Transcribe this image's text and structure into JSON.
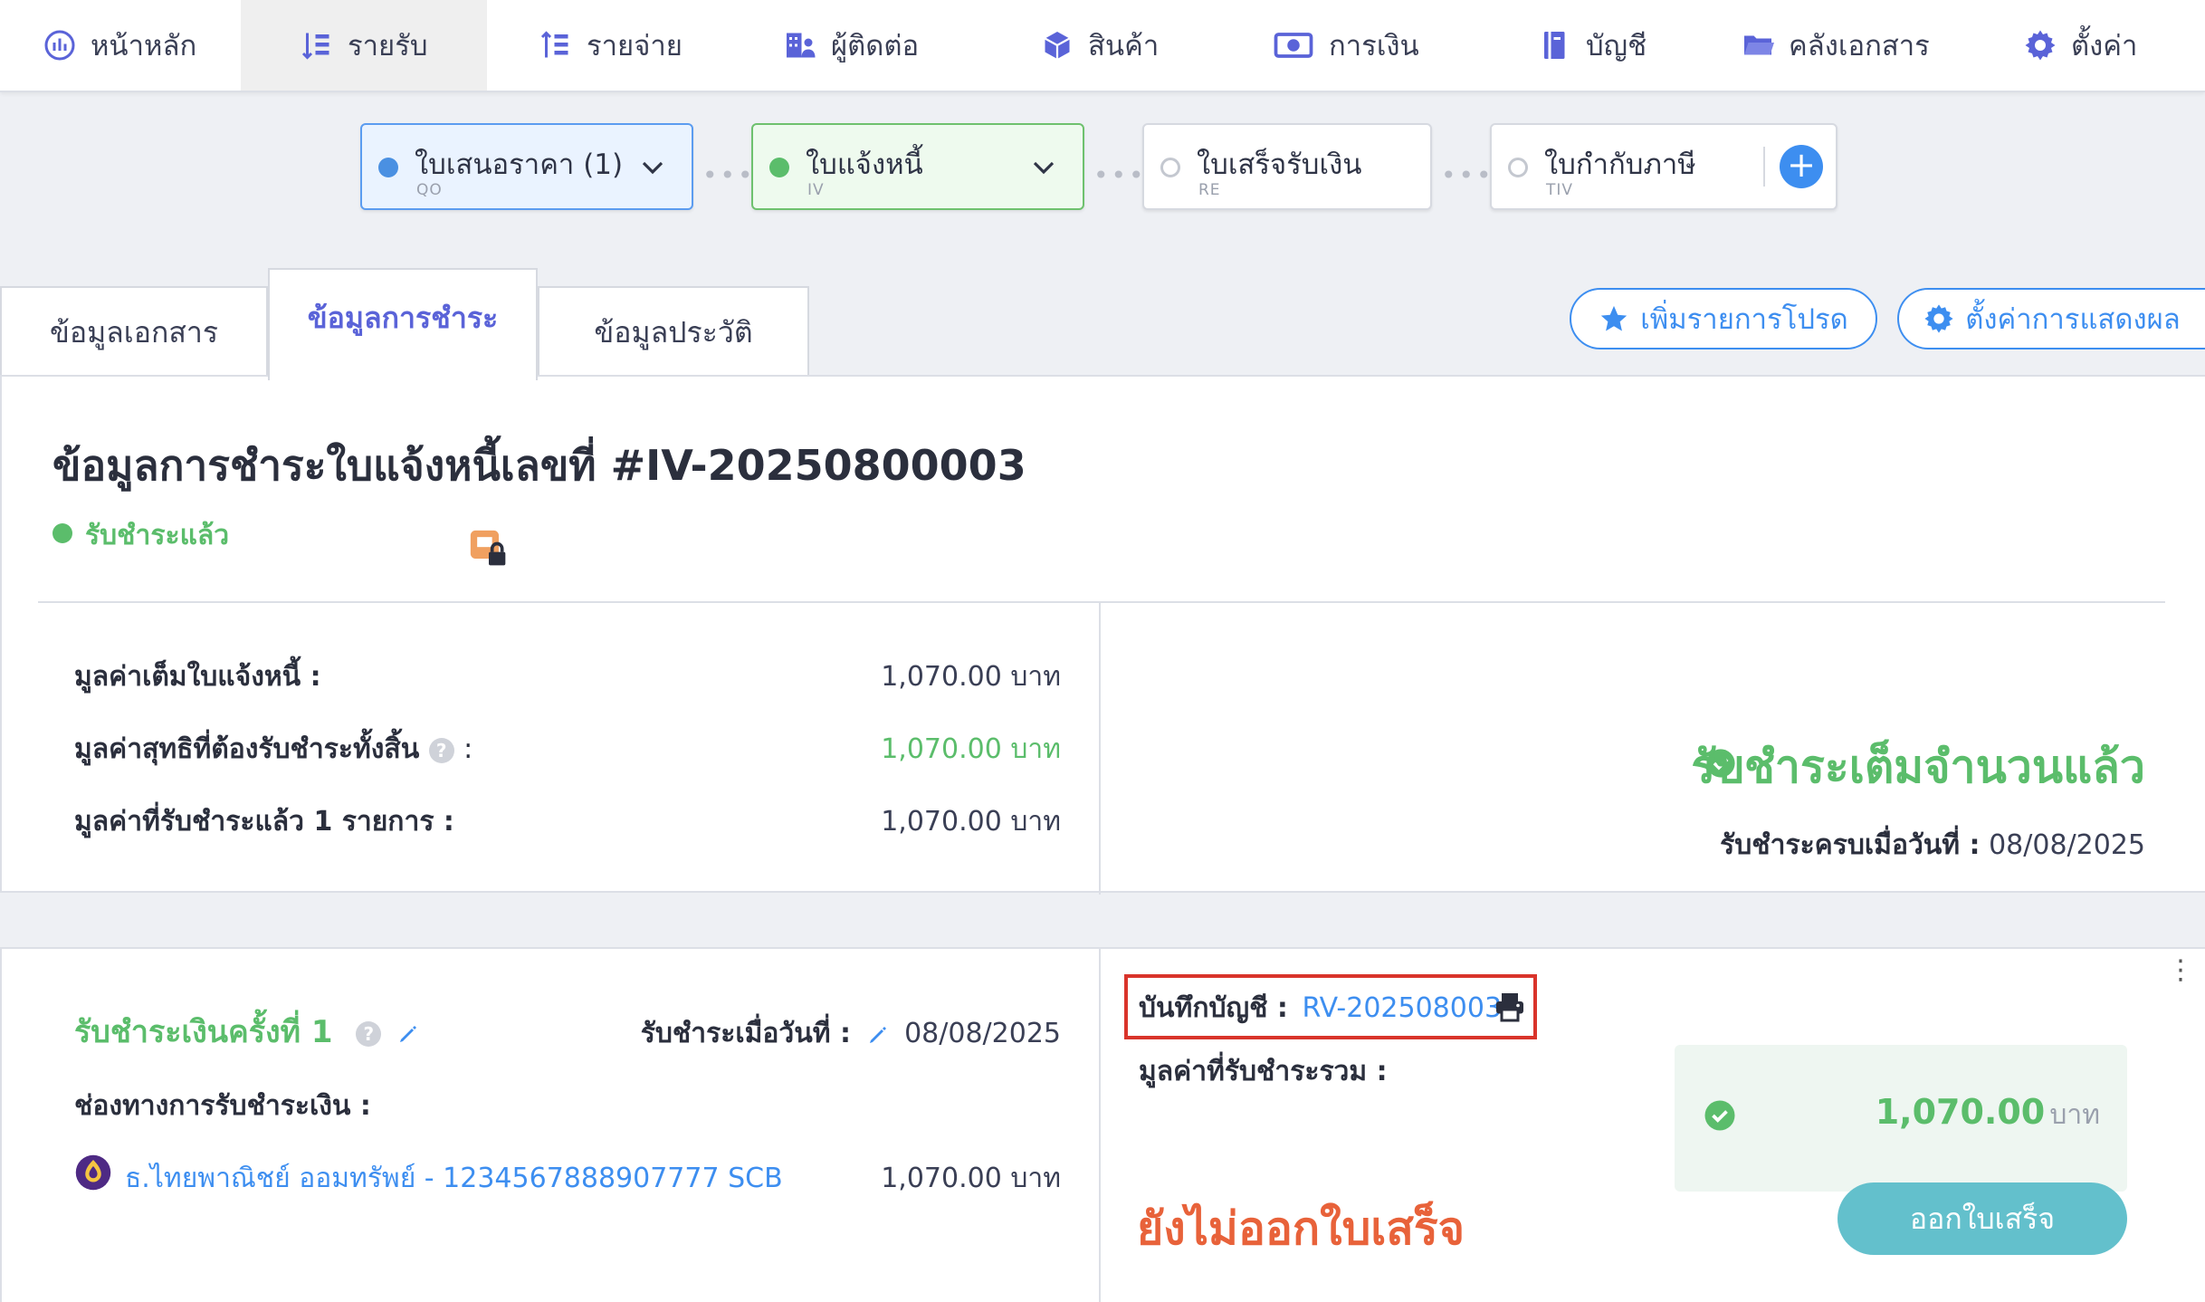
{
  "nav": {
    "items": [
      {
        "label": "หน้าหลัก",
        "icon": "dashboard-icon"
      },
      {
        "label": "รายรับ",
        "icon": "income-icon",
        "active": true
      },
      {
        "label": "รายจ่าย",
        "icon": "expense-icon"
      },
      {
        "label": "ผู้ติดต่อ",
        "icon": "contacts-icon"
      },
      {
        "label": "สินค้า",
        "icon": "product-box-icon"
      },
      {
        "label": "การเงิน",
        "icon": "money-icon"
      },
      {
        "label": "บัญชี",
        "icon": "accounting-book-icon"
      },
      {
        "label": "คลังเอกสาร",
        "icon": "folder-icon"
      },
      {
        "label": "ตั้งค่า",
        "icon": "gear-icon"
      }
    ]
  },
  "stepper": [
    {
      "title": "ใบเสนอราคา (1)",
      "code": "QO",
      "state": "done",
      "color": "#4a90e2"
    },
    {
      "title": "ใบแจ้งหนี้",
      "code": "IV",
      "state": "current",
      "color": "#5bbd6b"
    },
    {
      "title": "ใบเสร็จรับเงิน",
      "code": "RE",
      "state": "pending"
    },
    {
      "title": "ใบกำกับภาษี",
      "code": "TIV",
      "state": "pending"
    }
  ],
  "tabs": [
    "ข้อมูลเอกสาร",
    "ข้อมูลการชำระ",
    "ข้อมูลประวัติ"
  ],
  "actions": {
    "favorite": "เพิ่มรายการโปรด",
    "display_settings": "ตั้งค่าการแสดงผล"
  },
  "summary": {
    "title": "ข้อมูลการชำระใบแจ้งหนี้เลขที่ #IV-20250800003",
    "status": "รับชำระแล้ว",
    "full_value_label": "มูลค่าเต็มใบแจ้งหนี้ :",
    "full_value": "1,070.00 บาท",
    "net_value_label": "มูลค่าสุทธิที่ต้องรับชำระทั้งสิ้น",
    "net_value_colon": ":",
    "net_value": "1,070.00 บาท",
    "paid_label": "มูลค่าที่รับชำระแล้ว 1 รายการ :",
    "paid_value": "1,070.00 บาท",
    "paid_full_message": "รับชำระเต็มจำนวนแล้ว",
    "paid_date_label": "รับชำระครบเมื่อวันที่ :",
    "paid_date": "08/08/2025"
  },
  "payment": {
    "title": "รับชำระเงินครั้งที่ 1",
    "date_label": "รับชำระเมื่อวันที่ :",
    "date": "08/08/2025",
    "channel_label": "ช่องทางการรับชำระเงิน :",
    "channel": "ธ.ไทยพาณิชย์ ออมทรัพย์ - 1234567888907777 SCB",
    "channel_amount": "1,070.00 บาท",
    "journal_label": "บันทึกบัญชี :",
    "journal_no": "RV-202508003",
    "total_label": "มูลค่าที่รับชำระรวม :",
    "total_amount": "1,070.00",
    "total_unit": "บาท",
    "receipt_status": "ยังไม่ออกใบเสร็จ",
    "issue_button": "ออกใบเสร็จ"
  },
  "colors": {
    "accent_blue": "#3d8ef0",
    "success_green": "#5bbd6b",
    "warning_orange": "#e8623a",
    "teal_button": "#63c0cc",
    "highlight_red": "#d9342b"
  }
}
